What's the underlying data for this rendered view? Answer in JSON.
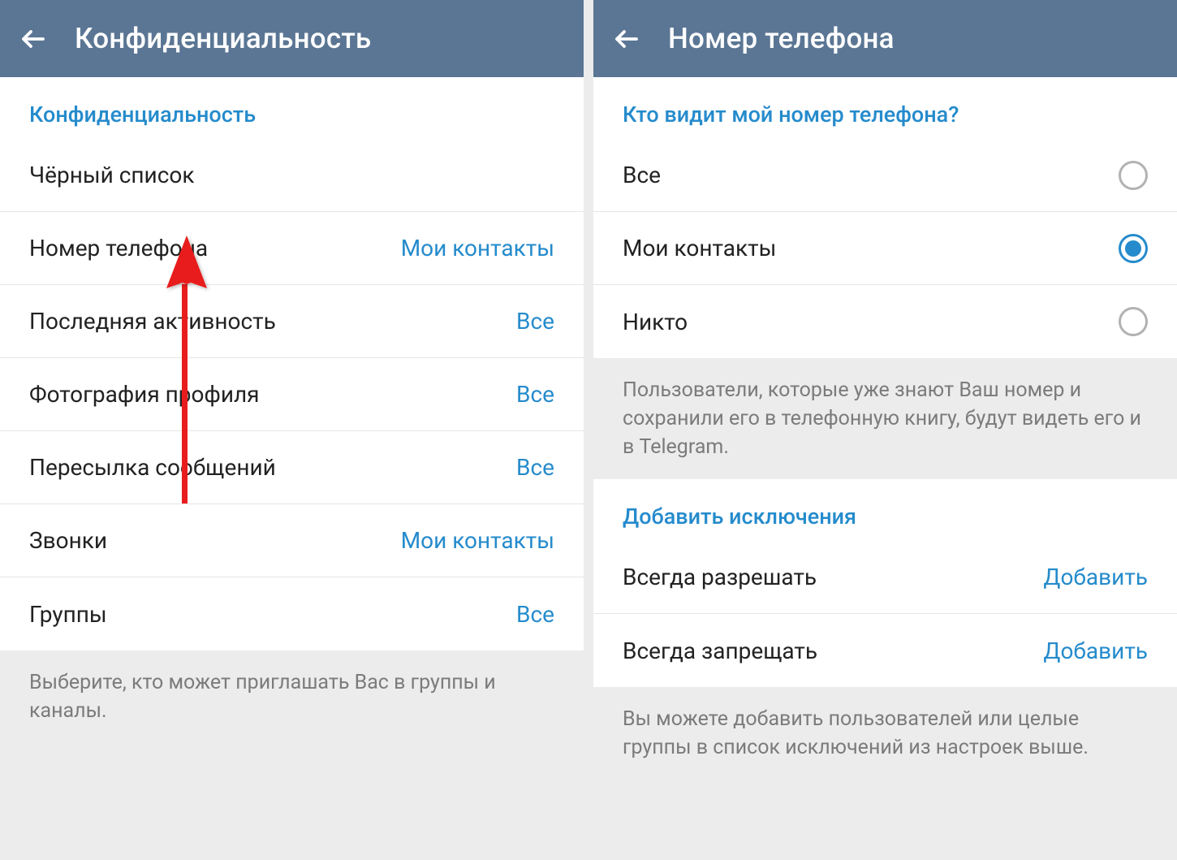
{
  "left": {
    "header_title": "Конфиденциальность",
    "section_title": "Конфиденциальность",
    "rows": {
      "blacklist": "Чёрный список",
      "phone_label": "Номер телефона",
      "phone_value": "Мои контакты",
      "last_seen_label": "Последняя активность",
      "last_seen_value": "Все",
      "profile_photo_label": "Фотография профиля",
      "profile_photo_value": "Все",
      "forward_label": "Пересылка сообщений",
      "forward_value": "Все",
      "calls_label": "Звонки",
      "calls_value": "Мои контакты",
      "groups_label": "Группы",
      "groups_value": "Все"
    },
    "footer_note": "Выберите, кто может приглашать Вас в группы и каналы."
  },
  "right": {
    "header_title": "Номер телефона",
    "section_title": "Кто видит мой номер телефона?",
    "options": {
      "everybody": "Все",
      "contacts": "Мои контакты",
      "nobody": "Никто"
    },
    "info_note": "Пользователи, которые уже знают Ваш номер и сохранили его в телефонную книгу, будут видеть его и в Telegram.",
    "exceptions_title": "Добавить исключения",
    "always_allow_label": "Всегда разрешать",
    "always_deny_label": "Всегда запрещать",
    "add_label": "Добавить",
    "footer_note": "Вы можете добавить пользователей или целые группы в список исключений из настроек выше."
  }
}
